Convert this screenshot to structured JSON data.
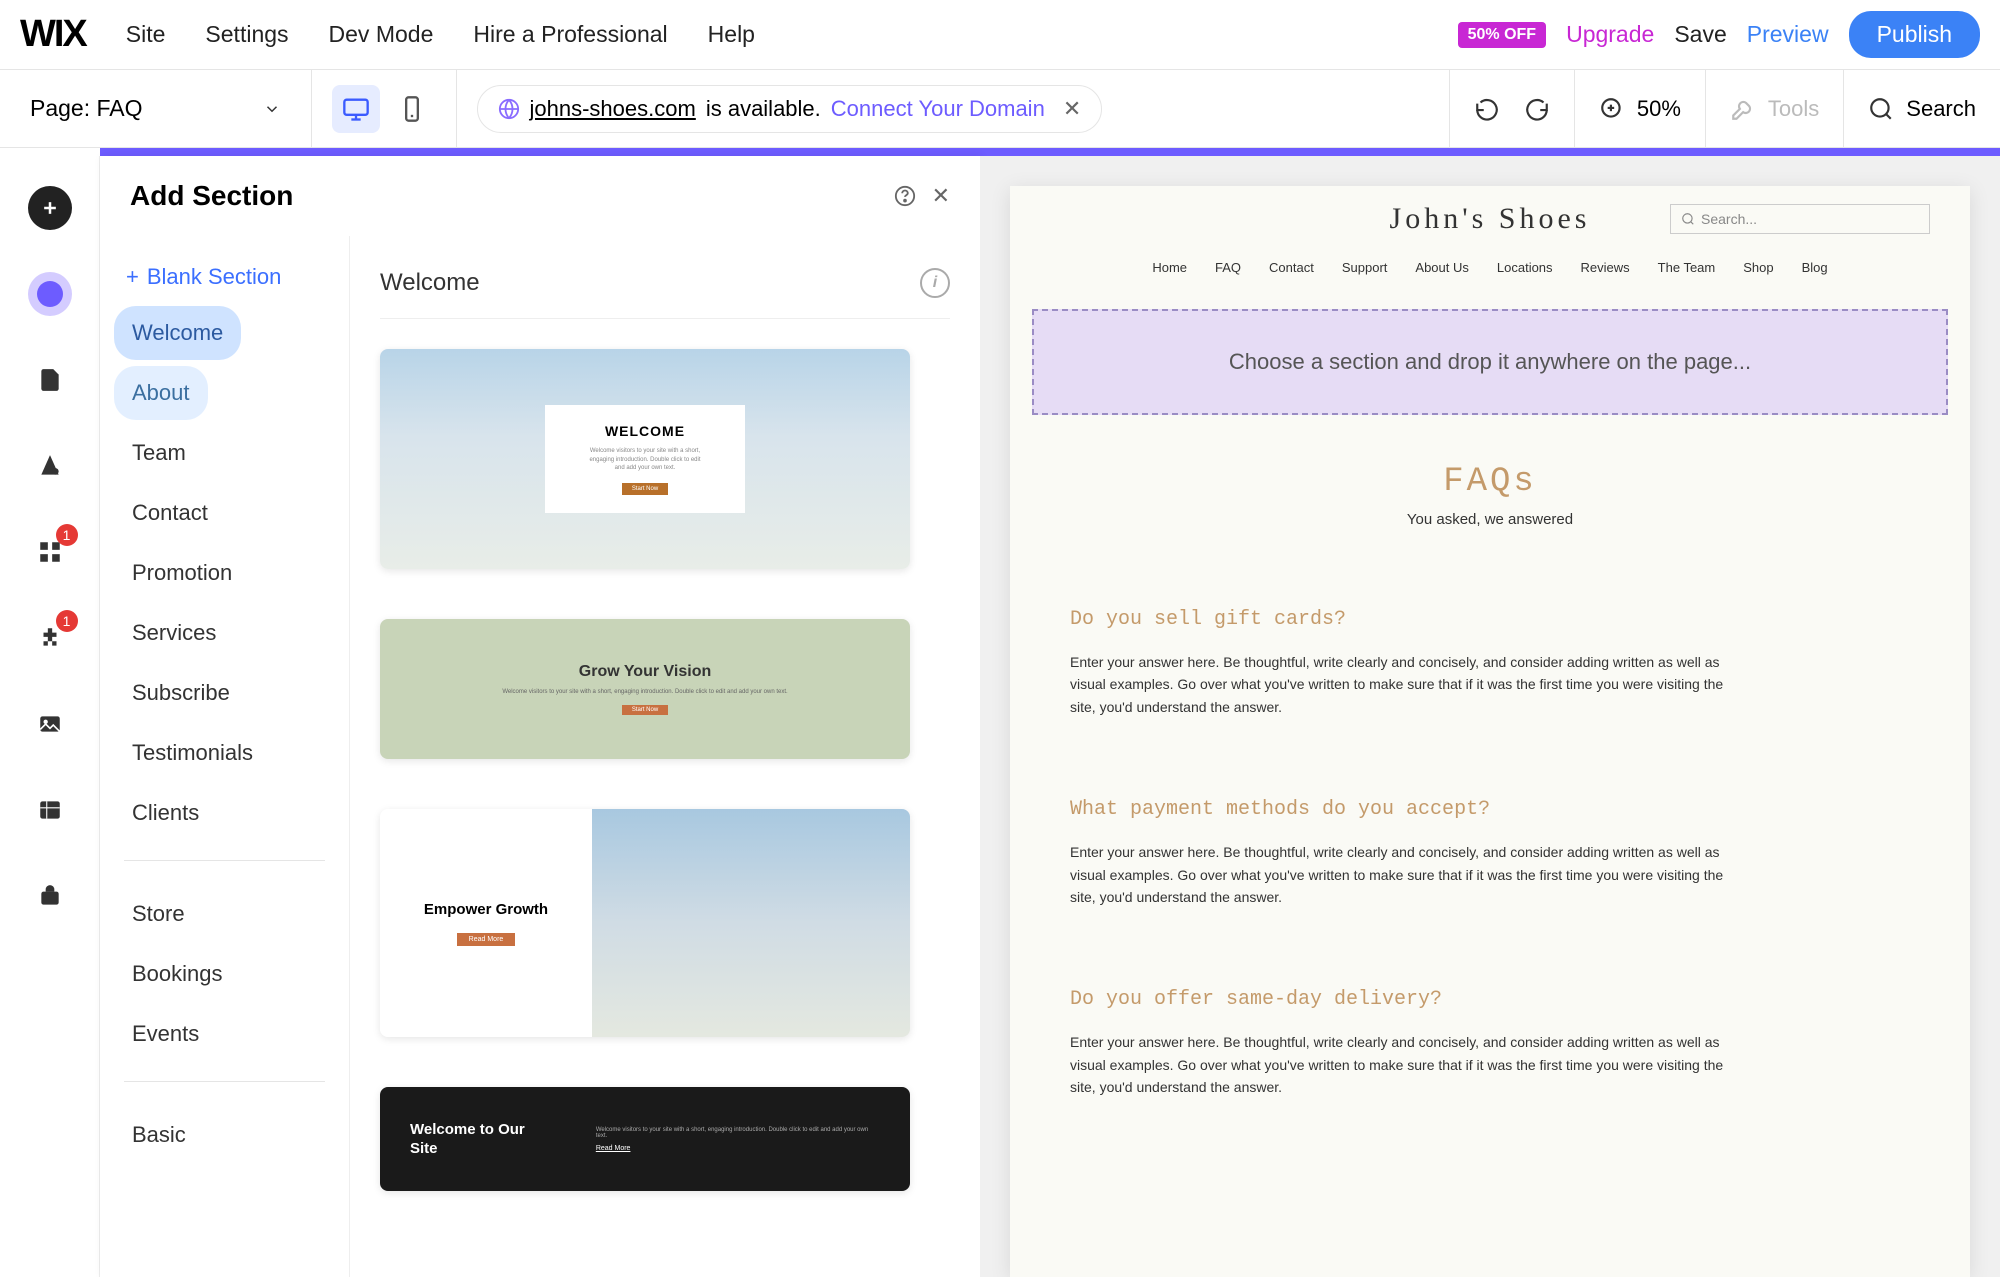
{
  "menubar": {
    "items": [
      "Site",
      "Settings",
      "Dev Mode",
      "Hire a Professional",
      "Help"
    ],
    "off_badge": "50% OFF",
    "upgrade": "Upgrade",
    "save": "Save",
    "preview": "Preview",
    "publish": "Publish"
  },
  "toolbar": {
    "page_label": "Page: FAQ",
    "domain": "johns-shoes.com",
    "domain_available": "is available.",
    "connect_domain": "Connect Your Domain",
    "zoom": "50%",
    "tools": "Tools",
    "search": "Search"
  },
  "left_rail": {
    "badges": {
      "apps": "1",
      "integrations": "1"
    }
  },
  "panel": {
    "title": "Add Section",
    "blank": "Blank Section",
    "categories": [
      "Welcome",
      "About",
      "Team",
      "Contact",
      "Promotion",
      "Services",
      "Subscribe",
      "Testimonials",
      "Clients"
    ],
    "categories2": [
      "Store",
      "Bookings",
      "Events"
    ],
    "categories3": [
      "Basic"
    ],
    "selected_category": "Welcome",
    "templates": {
      "t1_title": "WELCOME",
      "t1_sub": "Welcome visitors to your site with a short, engaging introduction. Double click to edit and add your own text.",
      "t1_btn": "Start Now",
      "t2_title": "Grow Your Vision",
      "t2_sub": "Welcome visitors to your site with a short, engaging introduction. Double click to edit and add your own text.",
      "t2_btn": "Start Now",
      "t3_title": "Empower Growth",
      "t3_btn": "Read More",
      "t4_title": "Welcome to Our Site",
      "t4_sub": "Welcome visitors to your site with a short, engaging introduction. Double click to edit and add your own text.",
      "t4_more": "Read More"
    }
  },
  "site": {
    "title": "John's Shoes",
    "search_placeholder": "Search...",
    "nav": [
      "Home",
      "FAQ",
      "Contact",
      "Support",
      "About Us",
      "Locations",
      "Reviews",
      "The Team",
      "Shop",
      "Blog"
    ],
    "drop_text": "Choose a section and drop it anywhere on the page...",
    "faq_title": "FAQs",
    "faq_sub": "You asked, we answered",
    "faqs": [
      {
        "q": "Do you sell gift cards?",
        "a": "Enter your answer here. Be thoughtful, write clearly and concisely, and consider adding written as well as visual examples. Go over what you've written to make sure that if it was the first time you were visiting the site, you'd understand the answer."
      },
      {
        "q": "What payment methods do you accept?",
        "a": "Enter your answer here. Be thoughtful, write clearly and concisely, and consider adding written as well as visual examples. Go over what you've written to make sure that if it was the first time you were visiting the site, you'd understand the answer."
      },
      {
        "q": "Do you offer same-day delivery?",
        "a": "Enter your answer here. Be thoughtful, write clearly and concisely, and consider adding written as well as visual examples. Go over what you've written to make sure that if it was the first time you were visiting the site, you'd understand the answer."
      }
    ]
  }
}
